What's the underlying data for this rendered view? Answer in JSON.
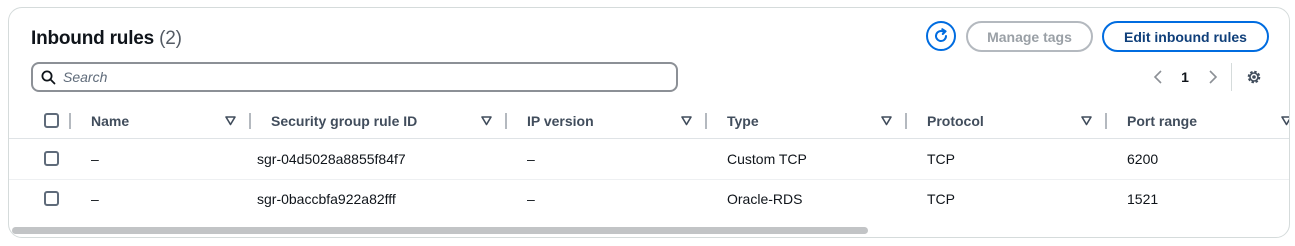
{
  "header": {
    "title": "Inbound rules",
    "count": "(2)",
    "manage_tags_label": "Manage tags",
    "edit_inbound_label": "Edit inbound rules"
  },
  "search": {
    "placeholder": "Search",
    "value": ""
  },
  "pagination": {
    "current_page": "1"
  },
  "table": {
    "columns": [
      "Name",
      "Security group rule ID",
      "IP version",
      "Type",
      "Protocol",
      "Port range"
    ],
    "rows": [
      {
        "name": "–",
        "rule_id": "sgr-04d5028a8855f84f7",
        "ip_version": "–",
        "type": "Custom TCP",
        "protocol": "TCP",
        "port_range": "6200"
      },
      {
        "name": "–",
        "rule_id": "sgr-0baccbfa922a82fff",
        "ip_version": "–",
        "type": "Oracle-RDS",
        "protocol": "TCP",
        "port_range": "1521"
      }
    ]
  },
  "colors": {
    "accent": "#006ce0",
    "disabled": "#b4b9bf",
    "text": "#0f141a",
    "header_text": "#414d5c"
  },
  "icons": [
    "refresh-icon",
    "search-icon",
    "chevron-left-icon",
    "chevron-right-icon",
    "settings-icon",
    "sort-icon"
  ]
}
